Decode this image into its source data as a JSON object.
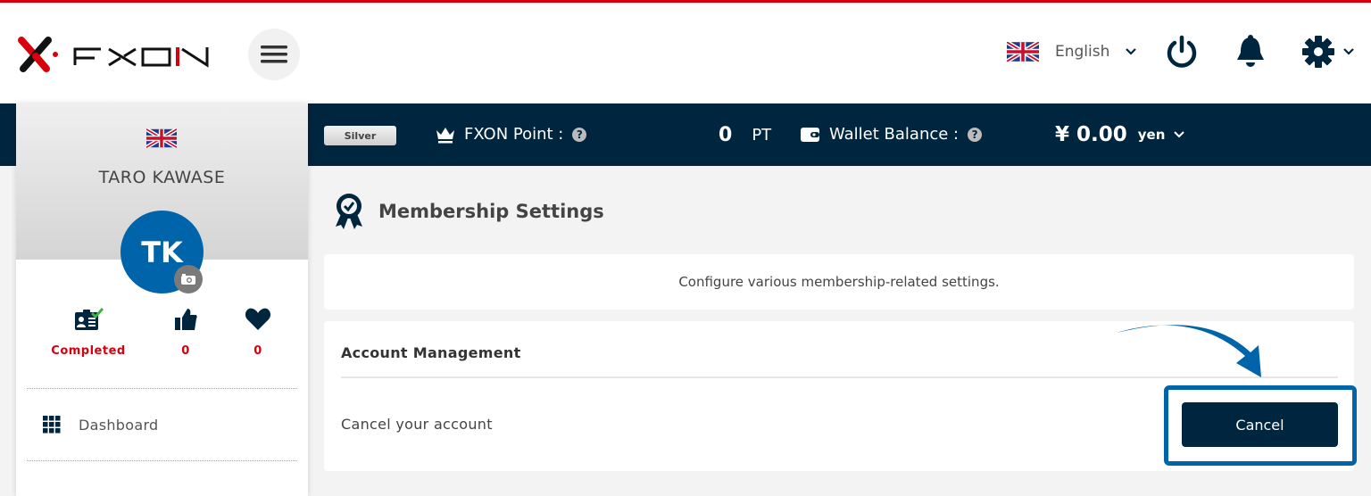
{
  "header": {
    "brand": "FXON",
    "language": "English",
    "icons": [
      "menu-icon",
      "uk-flag-icon",
      "chevron-down-icon",
      "power-icon",
      "bell-icon",
      "gear-icon"
    ]
  },
  "infobar": {
    "rank_badge": "Silver",
    "point_label": "FXON Point :",
    "point_value": "0",
    "point_unit": "PT",
    "wallet_label": "Wallet Balance :",
    "wallet_value": "¥ 0.00",
    "wallet_unit": "yen",
    "help_glyph": "?"
  },
  "sidebar": {
    "user_name": "TARO KAWASE",
    "avatar_initials": "TK",
    "stats": [
      {
        "icon": "id-card-check-icon",
        "value": "Completed"
      },
      {
        "icon": "thumbs-up-icon",
        "value": "0"
      },
      {
        "icon": "heart-icon",
        "value": "0"
      }
    ],
    "nav": [
      {
        "icon": "grid-icon",
        "label": "Dashboard"
      }
    ]
  },
  "main": {
    "title": "Membership Settings",
    "description": "Configure various membership-related settings.",
    "section_title": "Account Management",
    "row_label": "Cancel your account",
    "cancel_button": "Cancel"
  },
  "colors": {
    "brand_red": "#d8000c",
    "navy": "#00253f",
    "accent_blue": "#0064aa"
  }
}
